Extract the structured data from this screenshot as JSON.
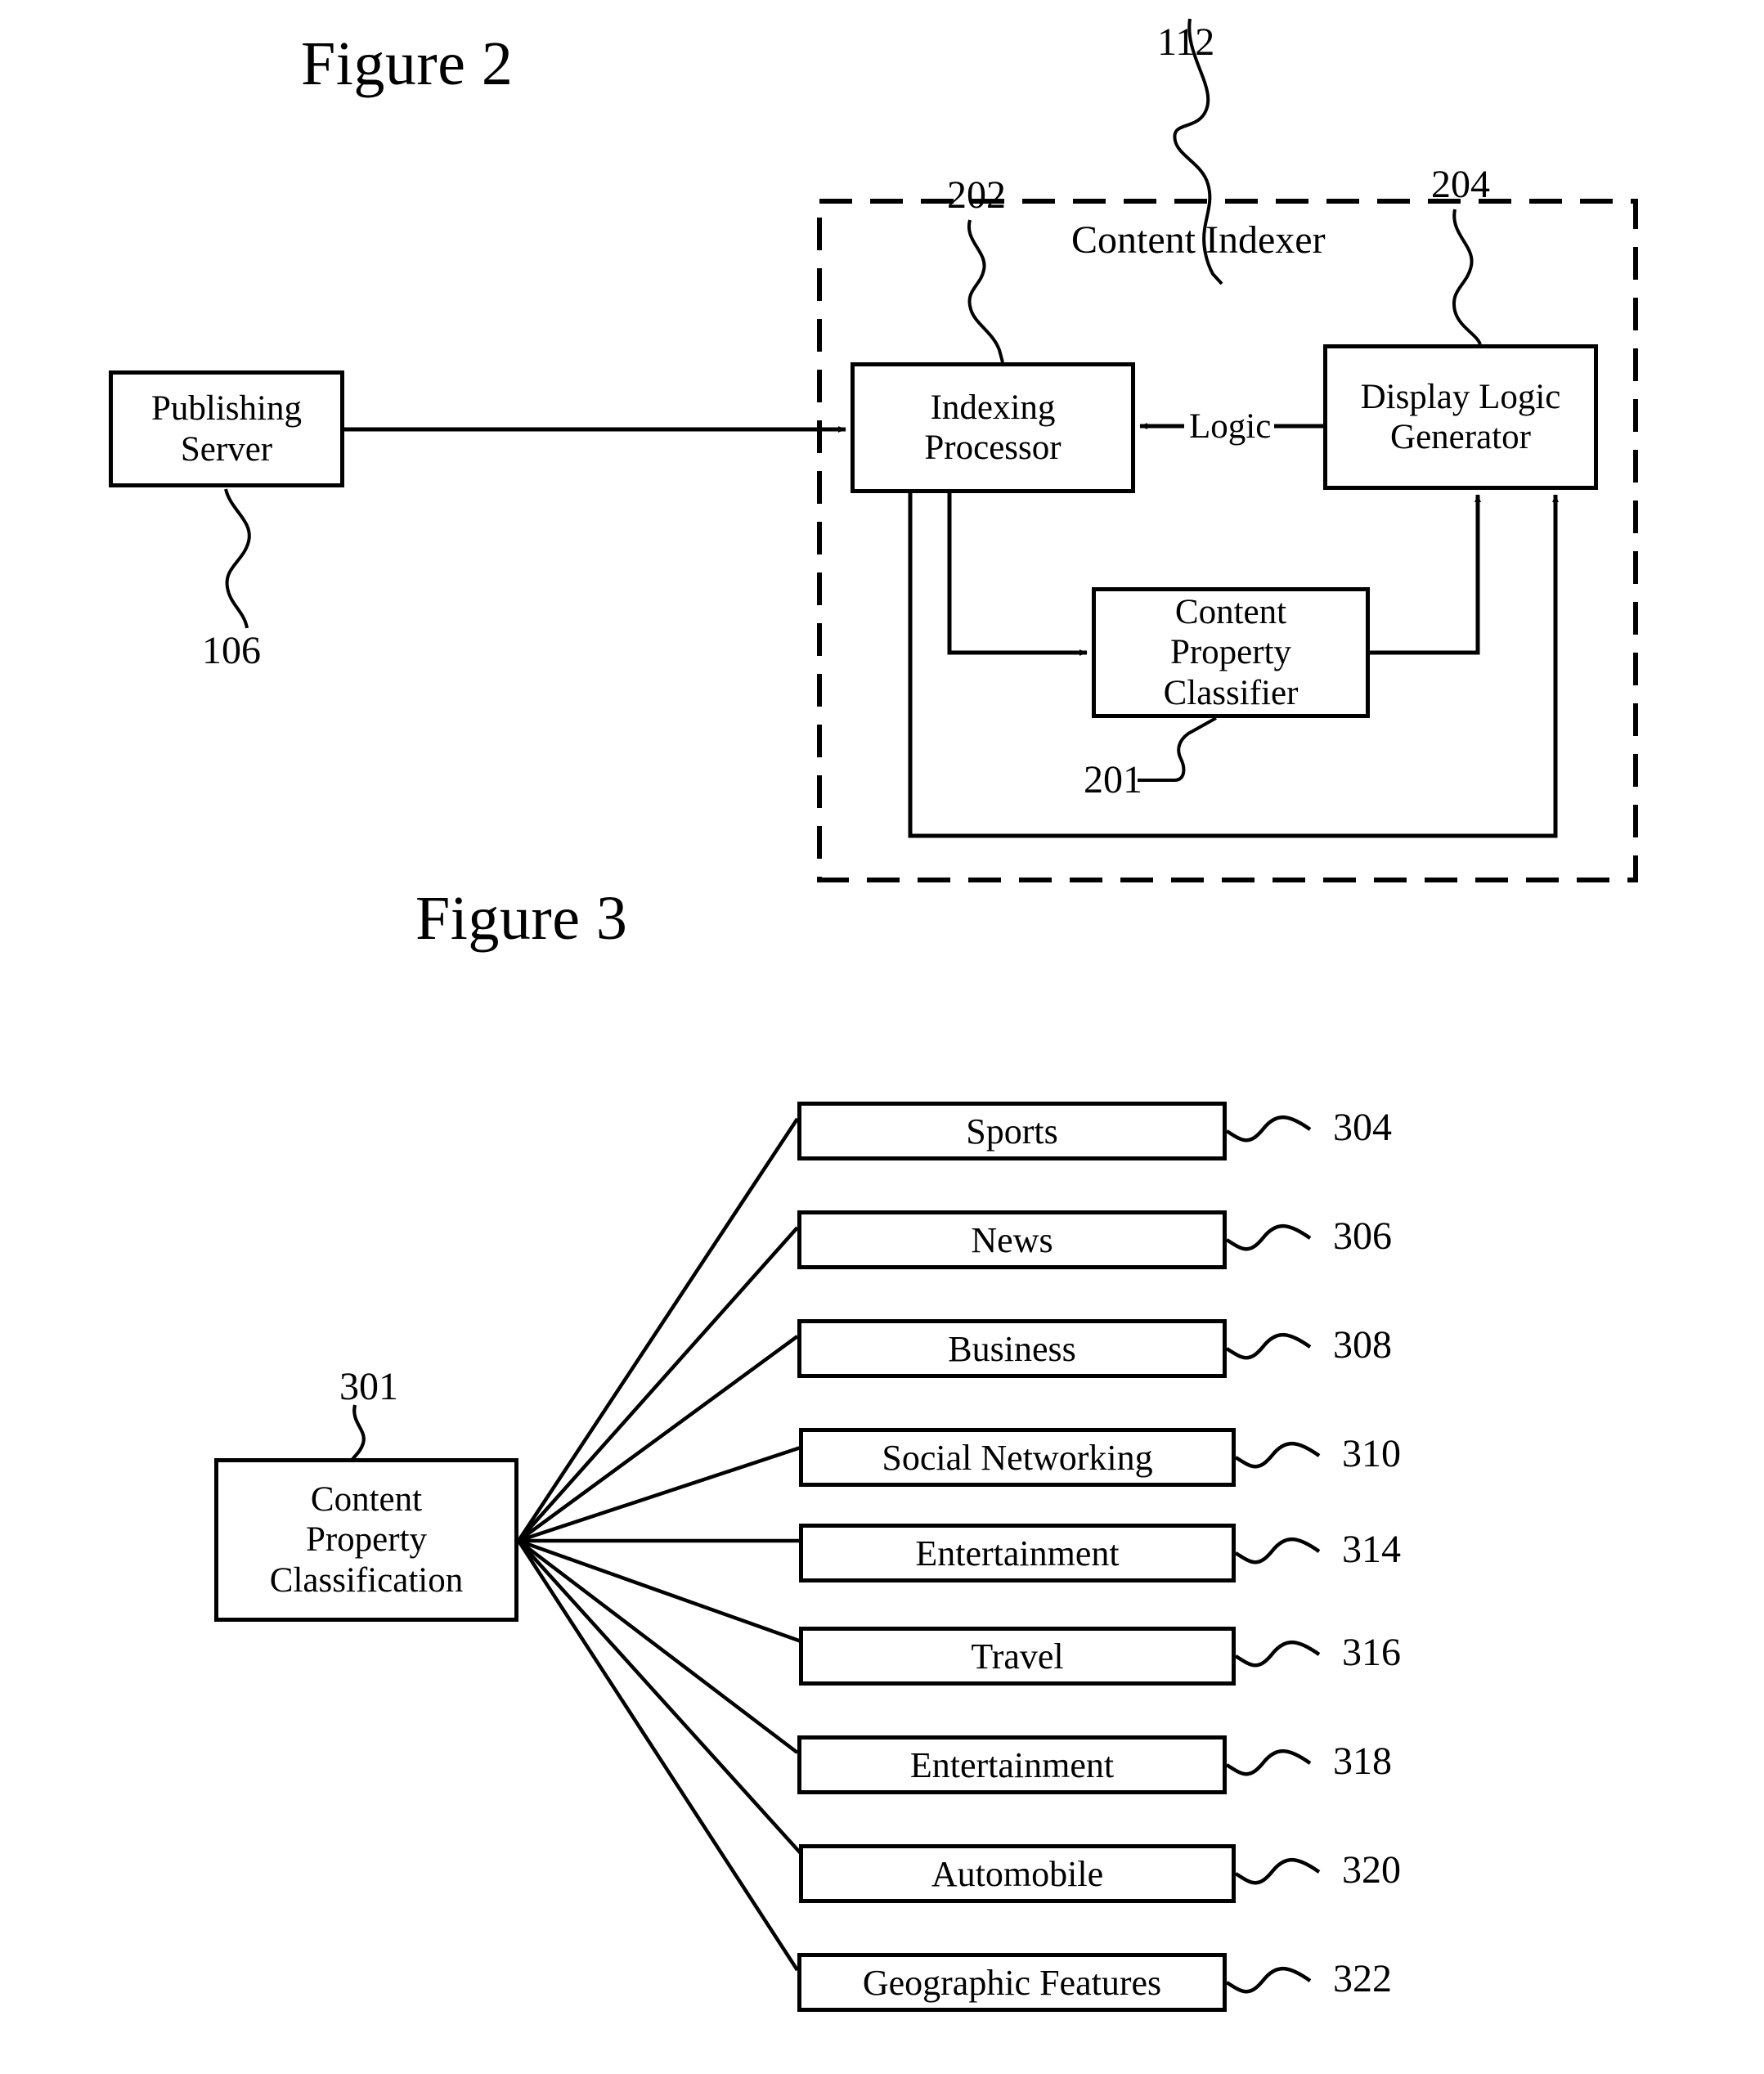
{
  "figure2": {
    "title": "Figure 2",
    "container": {
      "caption": "Content Indexer",
      "ref": "112"
    },
    "nodes": {
      "publishing_server": {
        "label": "Publishing\nServer",
        "ref": "106"
      },
      "indexing_processor": {
        "label": "Indexing\nProcessor",
        "ref": "202"
      },
      "display_logic_generator": {
        "label": "Display Logic\nGenerator",
        "ref": "204"
      },
      "content_property_classifier": {
        "label": "Content\nProperty\nClassifier",
        "ref": "201"
      }
    },
    "edges": {
      "logic_label": "Logic"
    }
  },
  "figure3": {
    "title": "Figure 3",
    "source": {
      "label": "Content\nProperty\nClassification",
      "ref": "301"
    },
    "categories": [
      {
        "label": "Sports",
        "ref": "304"
      },
      {
        "label": "News",
        "ref": "306"
      },
      {
        "label": "Business",
        "ref": "308"
      },
      {
        "label": "Social Networking",
        "ref": "310"
      },
      {
        "label": "Entertainment",
        "ref": "314"
      },
      {
        "label": "Travel",
        "ref": "316"
      },
      {
        "label": "Entertainment",
        "ref": "318"
      },
      {
        "label": "Automobile",
        "ref": "320"
      },
      {
        "label": "Geographic Features",
        "ref": "322"
      }
    ]
  },
  "style": {
    "ink": "#000000",
    "paper": "#ffffff"
  }
}
